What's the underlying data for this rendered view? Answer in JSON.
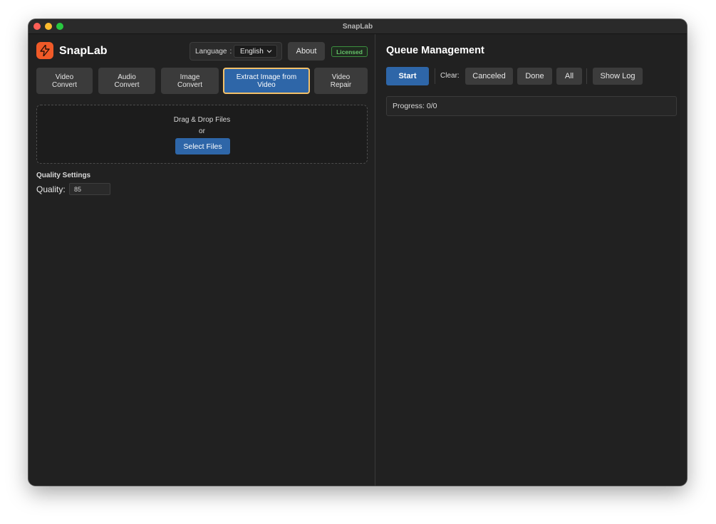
{
  "window": {
    "title": "SnapLab"
  },
  "header": {
    "app_name": "SnapLab",
    "logo_icon": "lightning-bolt-icon",
    "language_label": "Language",
    "language_separator": ":",
    "language_value": "English",
    "about_label": "About",
    "license_badge": "Licensed"
  },
  "tabs": [
    {
      "label": "Video\nConvert",
      "active": false
    },
    {
      "label": "Audio\nConvert",
      "active": false
    },
    {
      "label": "Image\nConvert",
      "active": false
    },
    {
      "label": "Extract Image from\nVideo",
      "active": true
    },
    {
      "label": "Video\nRepair",
      "active": false
    }
  ],
  "dropzone": {
    "text": "Drag & Drop Files",
    "or": "or",
    "select_button": "Select Files"
  },
  "quality": {
    "heading": "Quality Settings",
    "label": "Quality:",
    "value": "85"
  },
  "queue": {
    "title": "Queue Management",
    "start_button": "Start",
    "clear_label": "Clear:",
    "canceled_button": "Canceled",
    "done_button": "Done",
    "all_button": "All",
    "show_log_button": "Show Log",
    "progress_text": "Progress: 0/0"
  },
  "colors": {
    "accent_blue": "#2e66a8",
    "active_tab_border": "#f3c16a",
    "logo_orange": "#f05a28",
    "licensed_green": "#66c26a",
    "background": "#212121"
  }
}
